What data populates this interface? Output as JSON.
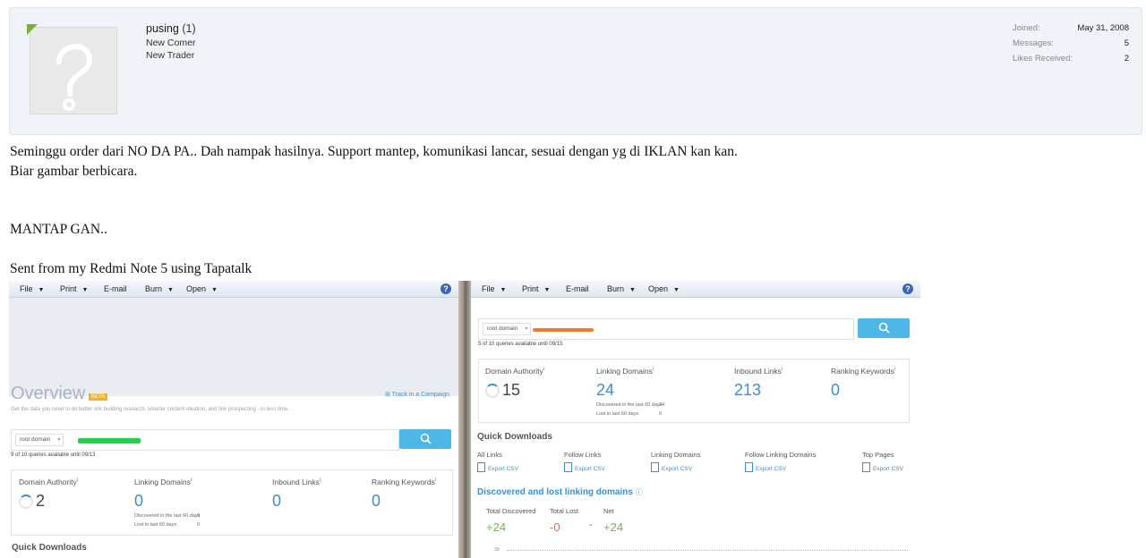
{
  "user": {
    "name": "pusing",
    "count": "(1)",
    "titles": [
      "New Comer",
      "New Trader"
    ],
    "stats": [
      {
        "label": "Joined:",
        "value": "May 31, 2008"
      },
      {
        "label": "Messages:",
        "value": "5"
      },
      {
        "label": "Likes Received:",
        "value": "2"
      }
    ]
  },
  "message": {
    "lines": [
      "Seminggu order dari NO DA PA.. Dah nampak hasilnya. Support mantep, komunikasi lancar, sesuai dengan yg di IKLAN kan kan.",
      "Biar gambar berbicara.",
      "MANTAP GAN..",
      "Sent from my Redmi Note 5 using Tapatalk"
    ]
  },
  "attachment": {
    "menu": [
      "File",
      "Print",
      "E-mail",
      "Burn",
      "Open"
    ],
    "help": "?",
    "left": {
      "overview_title": "Overview",
      "beta_badge": "BETA",
      "track_link": "Track in a Campaign",
      "subtitle": "Get the data you need to do better link building research, smarter content ideation, and link prospecting - in less time.",
      "dropdown": "root domain",
      "queries": "9 of 10 queries available until 09/13",
      "metrics": [
        {
          "label": "Domain Authority",
          "sup": "i",
          "value": "2"
        },
        {
          "label": "Linking Domains",
          "sup": "i",
          "value": "0",
          "sub": [
            [
              "Discovered in the last 60 days",
              "0"
            ],
            [
              "Lost in last 60 days",
              "0"
            ]
          ]
        },
        {
          "label": "Inbound Links",
          "sup": "i",
          "value": "0"
        },
        {
          "label": "Ranking Keywords",
          "sup": "i",
          "value": "0"
        }
      ],
      "quick_downloads": "Quick Downloads"
    },
    "right": {
      "dropdown": "root domain",
      "queries": "5 of 10 queries available until 09/15",
      "metrics": [
        {
          "label": "Domain Authority",
          "sup": "i",
          "value": "15"
        },
        {
          "label": "Linking Domains",
          "sup": "i",
          "value": "24",
          "sub": [
            [
              "Discovered in the last 60 days",
              "24"
            ],
            [
              "Lost in last 60 days",
              "0"
            ]
          ]
        },
        {
          "label": "Inbound Links",
          "sup": "i",
          "value": "213"
        },
        {
          "label": "Ranking Keywords",
          "sup": "i",
          "value": "0"
        }
      ],
      "quick_downloads": "Quick Downloads",
      "downloads": [
        "All Links",
        "Follow Links",
        "Linking Domains",
        "Follow Linking Domains",
        "Top Pages"
      ],
      "export_label": "Export CSV",
      "dl_title": "Discovered and lost linking domains",
      "dl_labels": [
        "Total Discovered",
        "Total Lost",
        "Net"
      ],
      "dl_values": [
        "+24",
        "-0",
        "+24"
      ],
      "dl_sep": "-",
      "axis_tick": "30"
    },
    "colors": {
      "accent": "#3a8fcf",
      "search_button": "#4fb7e8",
      "positive": "#6cba3a",
      "negative": "#e06a56",
      "redact_green": "#22d14a",
      "redact_orange": "#f07a2e"
    }
  }
}
